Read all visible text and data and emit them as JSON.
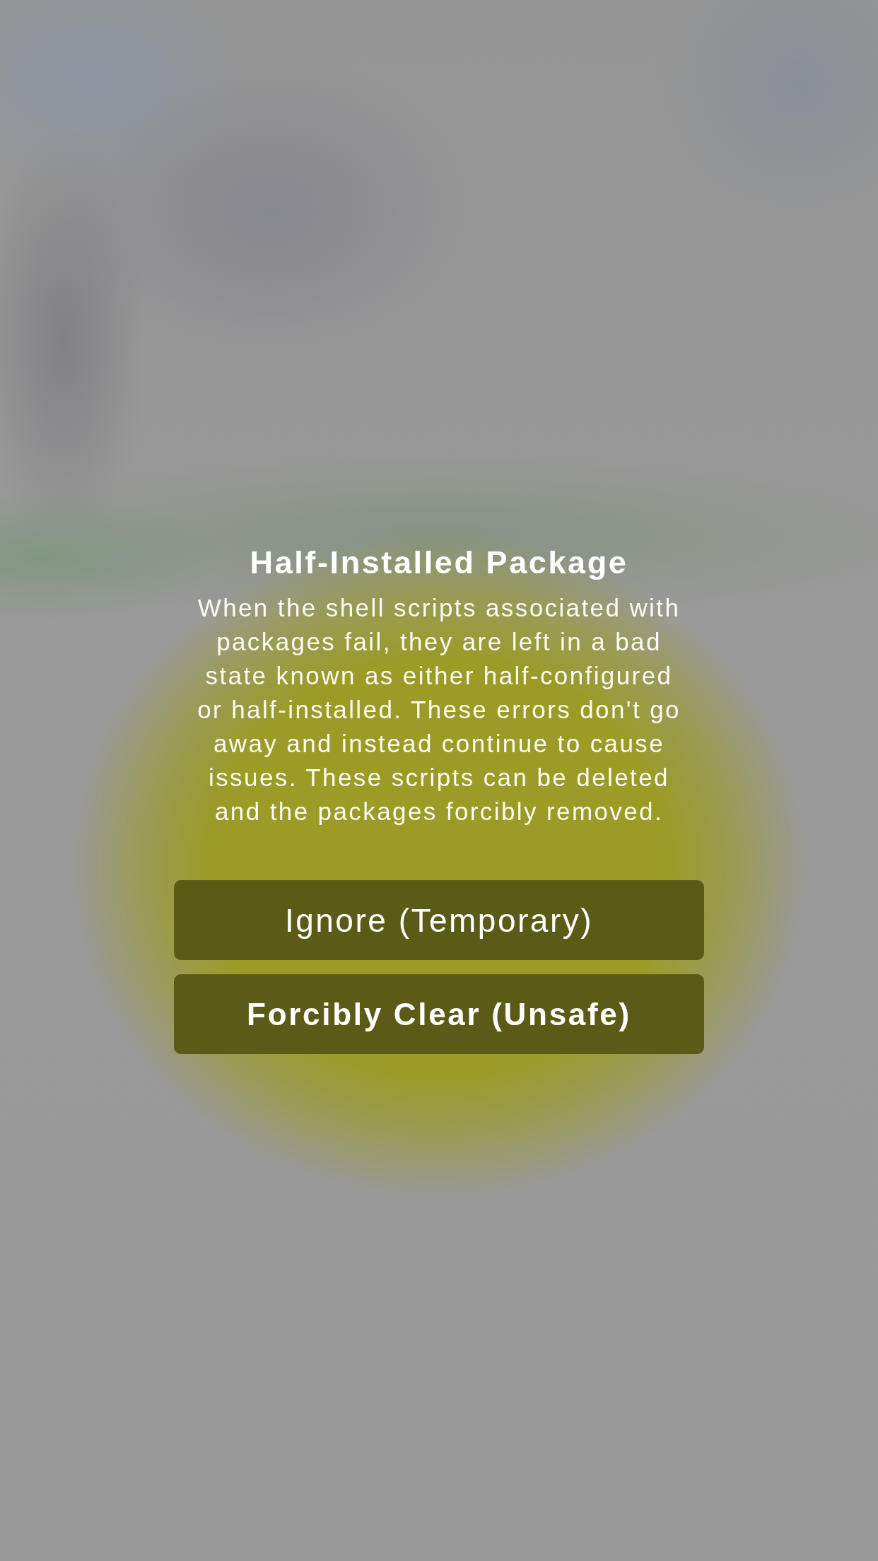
{
  "alert": {
    "title": "Half-Installed Package",
    "message": "When the shell scripts associated with\npackages fail, they are left in a bad\nstate known as either half-configured\nor half-installed. These errors don't go\naway and instead continue to cause\nissues. These scripts can be deleted\nand the packages forcibly removed.",
    "buttons": [
      {
        "label": "Ignore (Temporary)",
        "kind": "plain"
      },
      {
        "label": "Forcibly Clear (Unsafe)",
        "kind": "bold"
      }
    ]
  }
}
